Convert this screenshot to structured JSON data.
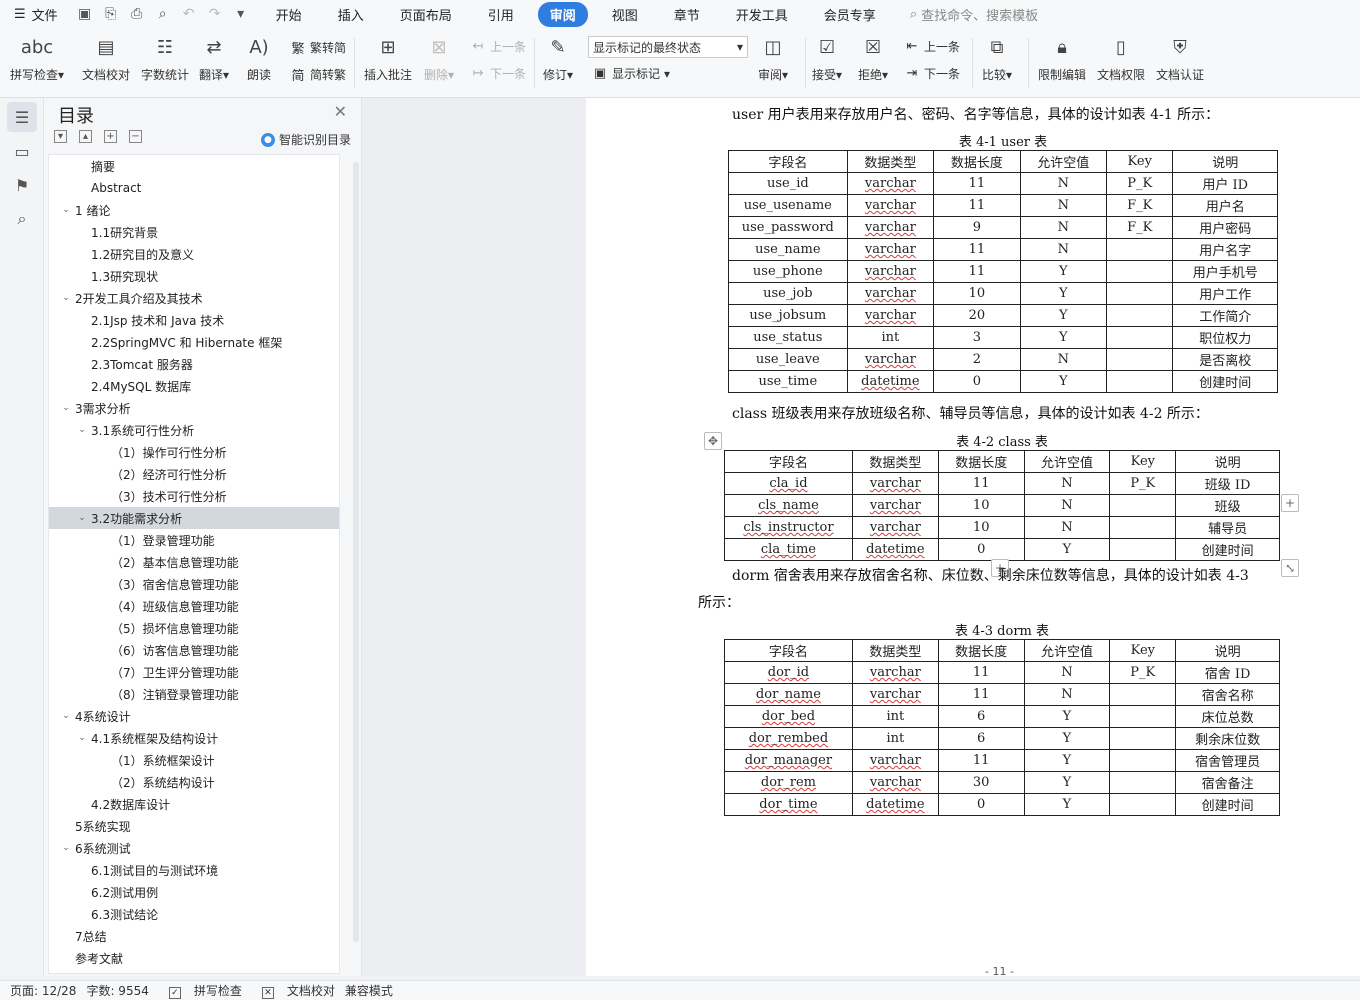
{
  "menubar": {
    "file_label": "文件",
    "tabs": [
      "开始",
      "插入",
      "页面布局",
      "引用",
      "审阅",
      "视图",
      "章节",
      "开发工具",
      "会员专享"
    ],
    "active_tab": "审阅",
    "search_placeholder": "查找命令、搜索模板"
  },
  "toolbar": {
    "spell_check": "拼写检查",
    "doc_proof": "文档校对",
    "word_count": "字数统计",
    "translate": "翻译",
    "read_aloud": "朗读",
    "trad_to_simp": "繁转简",
    "simp_to_trad": "简转繁",
    "insert_comment": "插入批注",
    "delete": "删除",
    "prev_comment": "上一条",
    "next_comment": "下一条",
    "revise": "修订",
    "markup_state": "显示标记的最终状态",
    "show_markup": "显示标记",
    "review": "审阅",
    "accept": "接受",
    "reject": "拒绝",
    "prev_change": "上一条",
    "next_change": "下一条",
    "compare": "比较",
    "restrict_edit": "限制编辑",
    "doc_permission": "文档权限",
    "doc_cert": "文档认证"
  },
  "toc": {
    "title": "目录",
    "smart_label": "智能识别目录",
    "items": [
      {
        "text": "摘要",
        "level": 1,
        "arrow": ""
      },
      {
        "text": "Abstract",
        "level": 1,
        "arrow": ""
      },
      {
        "text": "1 绪论",
        "level": 0,
        "arrow": "v"
      },
      {
        "text": "1.1研究背景",
        "level": 1,
        "arrow": ""
      },
      {
        "text": "1.2研究目的及意义",
        "level": 1,
        "arrow": ""
      },
      {
        "text": "1.3研究现状",
        "level": 1,
        "arrow": ""
      },
      {
        "text": "2开发工具介绍及其技术",
        "level": 0,
        "arrow": "v"
      },
      {
        "text": "2.1Jsp 技术和 Java 技术",
        "level": 1,
        "arrow": ""
      },
      {
        "text": "2.2SpringMVC 和 Hibernate 框架",
        "level": 1,
        "arrow": ""
      },
      {
        "text": "2.3Tomcat 服务器",
        "level": 1,
        "arrow": ""
      },
      {
        "text": "2.4MySQL 数据库",
        "level": 1,
        "arrow": ""
      },
      {
        "text": "3需求分析",
        "level": 0,
        "arrow": "v"
      },
      {
        "text": "3.1系统可行性分析",
        "level": 1,
        "arrow": "v"
      },
      {
        "text": "（1）操作可行性分析",
        "level": 2,
        "arrow": ""
      },
      {
        "text": "（2）经济可行性分析",
        "level": 2,
        "arrow": ""
      },
      {
        "text": "（3）技术可行性分析",
        "level": 2,
        "arrow": ""
      },
      {
        "text": "3.2功能需求分析",
        "level": 1,
        "arrow": "v"
      },
      {
        "text": "（1）登录管理功能",
        "level": 2,
        "arrow": ""
      },
      {
        "text": "（2）基本信息管理功能",
        "level": 2,
        "arrow": ""
      },
      {
        "text": "（3）宿舍信息管理功能",
        "level": 2,
        "arrow": ""
      },
      {
        "text": "（4）班级信息管理功能",
        "level": 2,
        "arrow": ""
      },
      {
        "text": "（5）损坏信息管理功能",
        "level": 2,
        "arrow": ""
      },
      {
        "text": "（6）访客信息管理功能",
        "level": 2,
        "arrow": ""
      },
      {
        "text": "（7）卫生评分管理功能",
        "level": 2,
        "arrow": ""
      },
      {
        "text": "（8）注销登录管理功能",
        "level": 2,
        "arrow": ""
      },
      {
        "text": "4系统设计",
        "level": 0,
        "arrow": "v"
      },
      {
        "text": "4.1系统框架及结构设计",
        "level": 1,
        "arrow": "v"
      },
      {
        "text": "（1）系统框架设计",
        "level": 2,
        "arrow": ""
      },
      {
        "text": "（2）系统结构设计",
        "level": 2,
        "arrow": ""
      },
      {
        "text": "4.2数据库设计",
        "level": 1,
        "arrow": ""
      },
      {
        "text": "5系统实现",
        "level": 0,
        "arrow": ""
      },
      {
        "text": "6系统测试",
        "level": 0,
        "arrow": "v"
      },
      {
        "text": "6.1测试目的与测试环境",
        "level": 1,
        "arrow": ""
      },
      {
        "text": "6.2测试用例",
        "level": 1,
        "arrow": ""
      },
      {
        "text": "6.3测试结论",
        "level": 1,
        "arrow": ""
      },
      {
        "text": "7总结",
        "level": 0,
        "arrow": ""
      },
      {
        "text": "参考文献",
        "level": 0,
        "arrow": ""
      }
    ],
    "selected_index": 16
  },
  "document": {
    "para1": "user 用户表用来存放用户名、密码、名字等信息，具体的设计如表  4-1 所示：",
    "table1_caption": "表  4-1 user 表",
    "para2": "class 班级表用来存放班级名称、辅导员等信息，具体的设计如表  4-2 所示：",
    "table2_caption": "表  4-2 class 表",
    "para3_line1": "dorm 宿舍表用来存放宿舍名称、床位数、剩余床位数等信息，具体的设计如表  4-3",
    "para3_line2": "所示：",
    "table3_caption": "表  4-3 dorm 表",
    "headers": [
      "字段名",
      "数据类型",
      "数据长度",
      "允许空值",
      "Key",
      "说明"
    ],
    "table1_rows": [
      [
        "use_id",
        "varchar",
        "11",
        "N",
        "P_K",
        "用户  ID"
      ],
      [
        "use_usename",
        "varchar",
        "11",
        "N",
        "F_K",
        "用户名"
      ],
      [
        "use_password",
        "varchar",
        "9",
        "N",
        "F_K",
        "用户密码"
      ],
      [
        "use_name",
        "varchar",
        "11",
        "N",
        "",
        "用户名字"
      ],
      [
        "use_phone",
        "varchar",
        "11",
        "Y",
        "",
        "用户手机号"
      ],
      [
        "use_job",
        "varchar",
        "10",
        "Y",
        "",
        "用户工作"
      ],
      [
        "use_jobsum",
        "varchar",
        "20",
        "Y",
        "",
        "工作简介"
      ],
      [
        "use_status",
        "int",
        "3",
        "Y",
        "",
        "职位权力"
      ],
      [
        "use_leave",
        "varchar",
        "2",
        "N",
        "",
        "是否离校"
      ],
      [
        "use_time",
        "datetime",
        "0",
        "Y",
        "",
        "创建时间"
      ]
    ],
    "table2_rows": [
      [
        "cla_id",
        "varchar",
        "11",
        "N",
        "P_K",
        "班级  ID"
      ],
      [
        "cls_name",
        "varchar",
        "10",
        "N",
        "",
        "班级"
      ],
      [
        "cls_instructor",
        "varchar",
        "10",
        "N",
        "",
        "辅导员"
      ],
      [
        "cla_time",
        "datetime",
        "0",
        "Y",
        "",
        "创建时间"
      ]
    ],
    "table3_rows": [
      [
        "dor_id",
        "varchar",
        "11",
        "N",
        "P_K",
        "宿舍  ID"
      ],
      [
        "dor_name",
        "varchar",
        "11",
        "N",
        "",
        "宿舍名称"
      ],
      [
        "dor_bed",
        "int",
        "6",
        "Y",
        "",
        "床位总数"
      ],
      [
        "dor_rembed",
        "int",
        "6",
        "Y",
        "",
        "剩余床位数"
      ],
      [
        "dor_manager",
        "varchar",
        "11",
        "Y",
        "",
        "宿舍管理员"
      ],
      [
        "dor_rem",
        "varchar",
        "30",
        "Y",
        "",
        "宿舍备注"
      ],
      [
        "dor_time",
        "datetime",
        "0",
        "Y",
        "",
        "创建时间"
      ]
    ],
    "page_footer": "- 11 -"
  },
  "status": {
    "page": "页面: 12/28",
    "words": "字数: 9554",
    "spell": "拼写检查",
    "proof": "文档校对",
    "compat": "兼容模式"
  },
  "colors": {
    "accent": "#2f7de1",
    "toc_selected": "#d3d8de",
    "spell_underline": "#d83b3b"
  }
}
